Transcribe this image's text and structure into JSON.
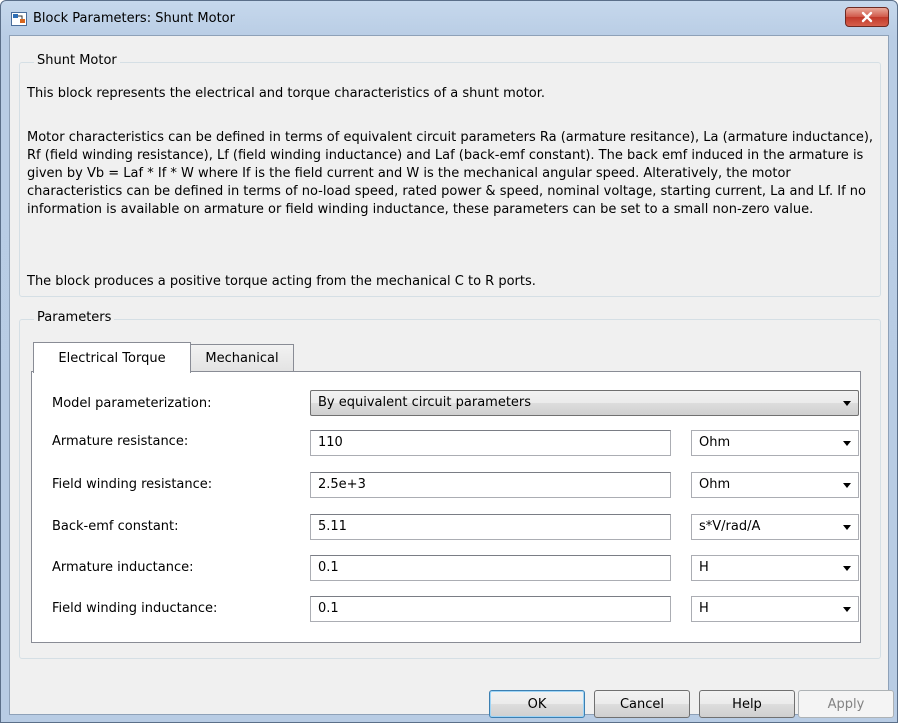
{
  "window": {
    "title": "Block Parameters: Shunt Motor"
  },
  "description": {
    "group_label": "Shunt Motor",
    "paragraphs": [
      "This block represents the electrical and torque characteristics of a shunt motor.",
      "Motor characteristics can be defined in terms of equivalent circuit parameters Ra (armature resitance), La (armature inductance), Rf (field winding resistance), Lf (field winding inductance) and Laf (back-emf constant). The back emf induced in the armature is given by Vb = Laf * If * W where If is the field current and W is the mechanical angular speed. Alteratively, the motor characteristics can be defined in terms of no-load speed, rated power & speed, nominal voltage, starting current, La and Lf. If no information is available on armature or field winding inductance, these parameters can be set to a small non-zero value.",
      "The block produces a positive torque acting from the mechanical C to R ports."
    ]
  },
  "parameters": {
    "group_label": "Parameters",
    "tabs": [
      {
        "label": "Electrical Torque",
        "active": true
      },
      {
        "label": "Mechanical",
        "active": false
      }
    ],
    "model_parameterization": {
      "label": "Model parameterization:",
      "value": "By equivalent circuit parameters"
    },
    "rows": [
      {
        "label": "Armature resistance:",
        "value": "110",
        "unit": "Ohm"
      },
      {
        "label": "Field winding resistance:",
        "value": "2.5e+3",
        "unit": "Ohm"
      },
      {
        "label": "Back-emf constant:",
        "value": "5.11",
        "unit": "s*V/rad/A"
      },
      {
        "label": "Armature inductance:",
        "value": "0.1",
        "unit": "H"
      },
      {
        "label": "Field winding inductance:",
        "value": "0.1",
        "unit": "H"
      }
    ]
  },
  "buttons": {
    "ok": "OK",
    "cancel": "Cancel",
    "help": "Help",
    "apply": "Apply"
  },
  "colors": {
    "title_bar": "#b9cde5",
    "close_button": "#c1392a",
    "dialog_background": "#f0f0f0",
    "default_button_border": "#3c7fb1"
  },
  "icons": {
    "app": "simulink-block-icon",
    "close": "close-icon",
    "dropdown": "chevron-down-icon"
  }
}
